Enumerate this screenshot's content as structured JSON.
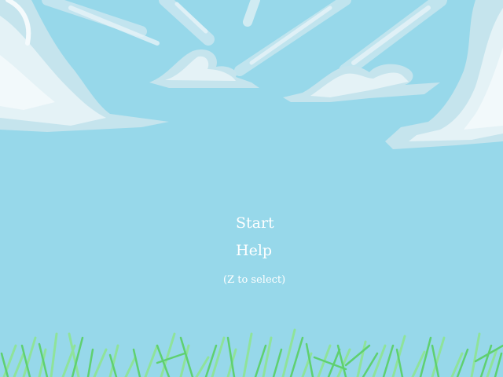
{
  "menu": {
    "items": [
      {
        "label": "Start"
      },
      {
        "label": "Help"
      }
    ],
    "hint": "(Z to select)"
  },
  "colors": {
    "sky": "#97d8ea",
    "cloud": "#e8f4f8",
    "cloud_shadow": "#b9dde8",
    "grass_light": "#8fe39a",
    "grass_dark": "#5fd070",
    "text": "#ffffff"
  }
}
